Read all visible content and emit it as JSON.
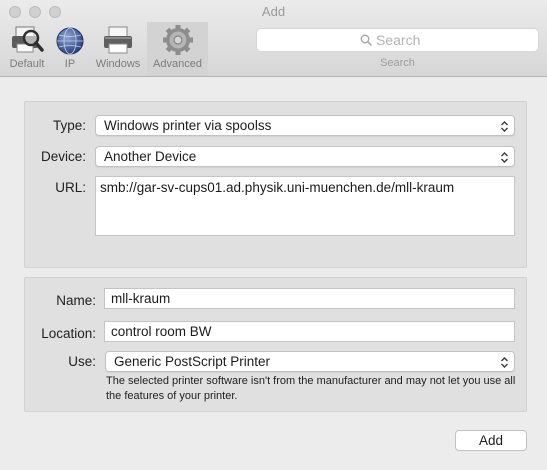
{
  "window": {
    "title": "Add"
  },
  "toolbar": {
    "items": [
      {
        "label": "Default",
        "icon": "default-printer-icon"
      },
      {
        "label": "IP",
        "icon": "globe-icon"
      },
      {
        "label": "Windows",
        "icon": "windows-printer-icon"
      },
      {
        "label": "Advanced",
        "icon": "gear-icon",
        "selected": true
      }
    ],
    "search": {
      "placeholder": "Search",
      "caption": "Search"
    }
  },
  "connection": {
    "type_label": "Type:",
    "type_value": "Windows printer via spoolss",
    "device_label": "Device:",
    "device_value": "Another Device",
    "url_label": "URL:",
    "url_value": "smb://gar-sv-cups01.ad.physik.uni-muenchen.de/mll-kraum"
  },
  "printer": {
    "name_label": "Name:",
    "name_value": "mll-kraum",
    "location_label": "Location:",
    "location_value": "control room BW",
    "use_label": "Use:",
    "use_value": "Generic PostScript Printer",
    "note": "The selected printer software isn't from the manufacturer and may not let you use all the features of your printer."
  },
  "actions": {
    "add_label": "Add"
  },
  "colors": {
    "window_bg": "#ececec",
    "panel_bg": "#e0e0e0",
    "selected_tab": "#d3d3d3"
  }
}
